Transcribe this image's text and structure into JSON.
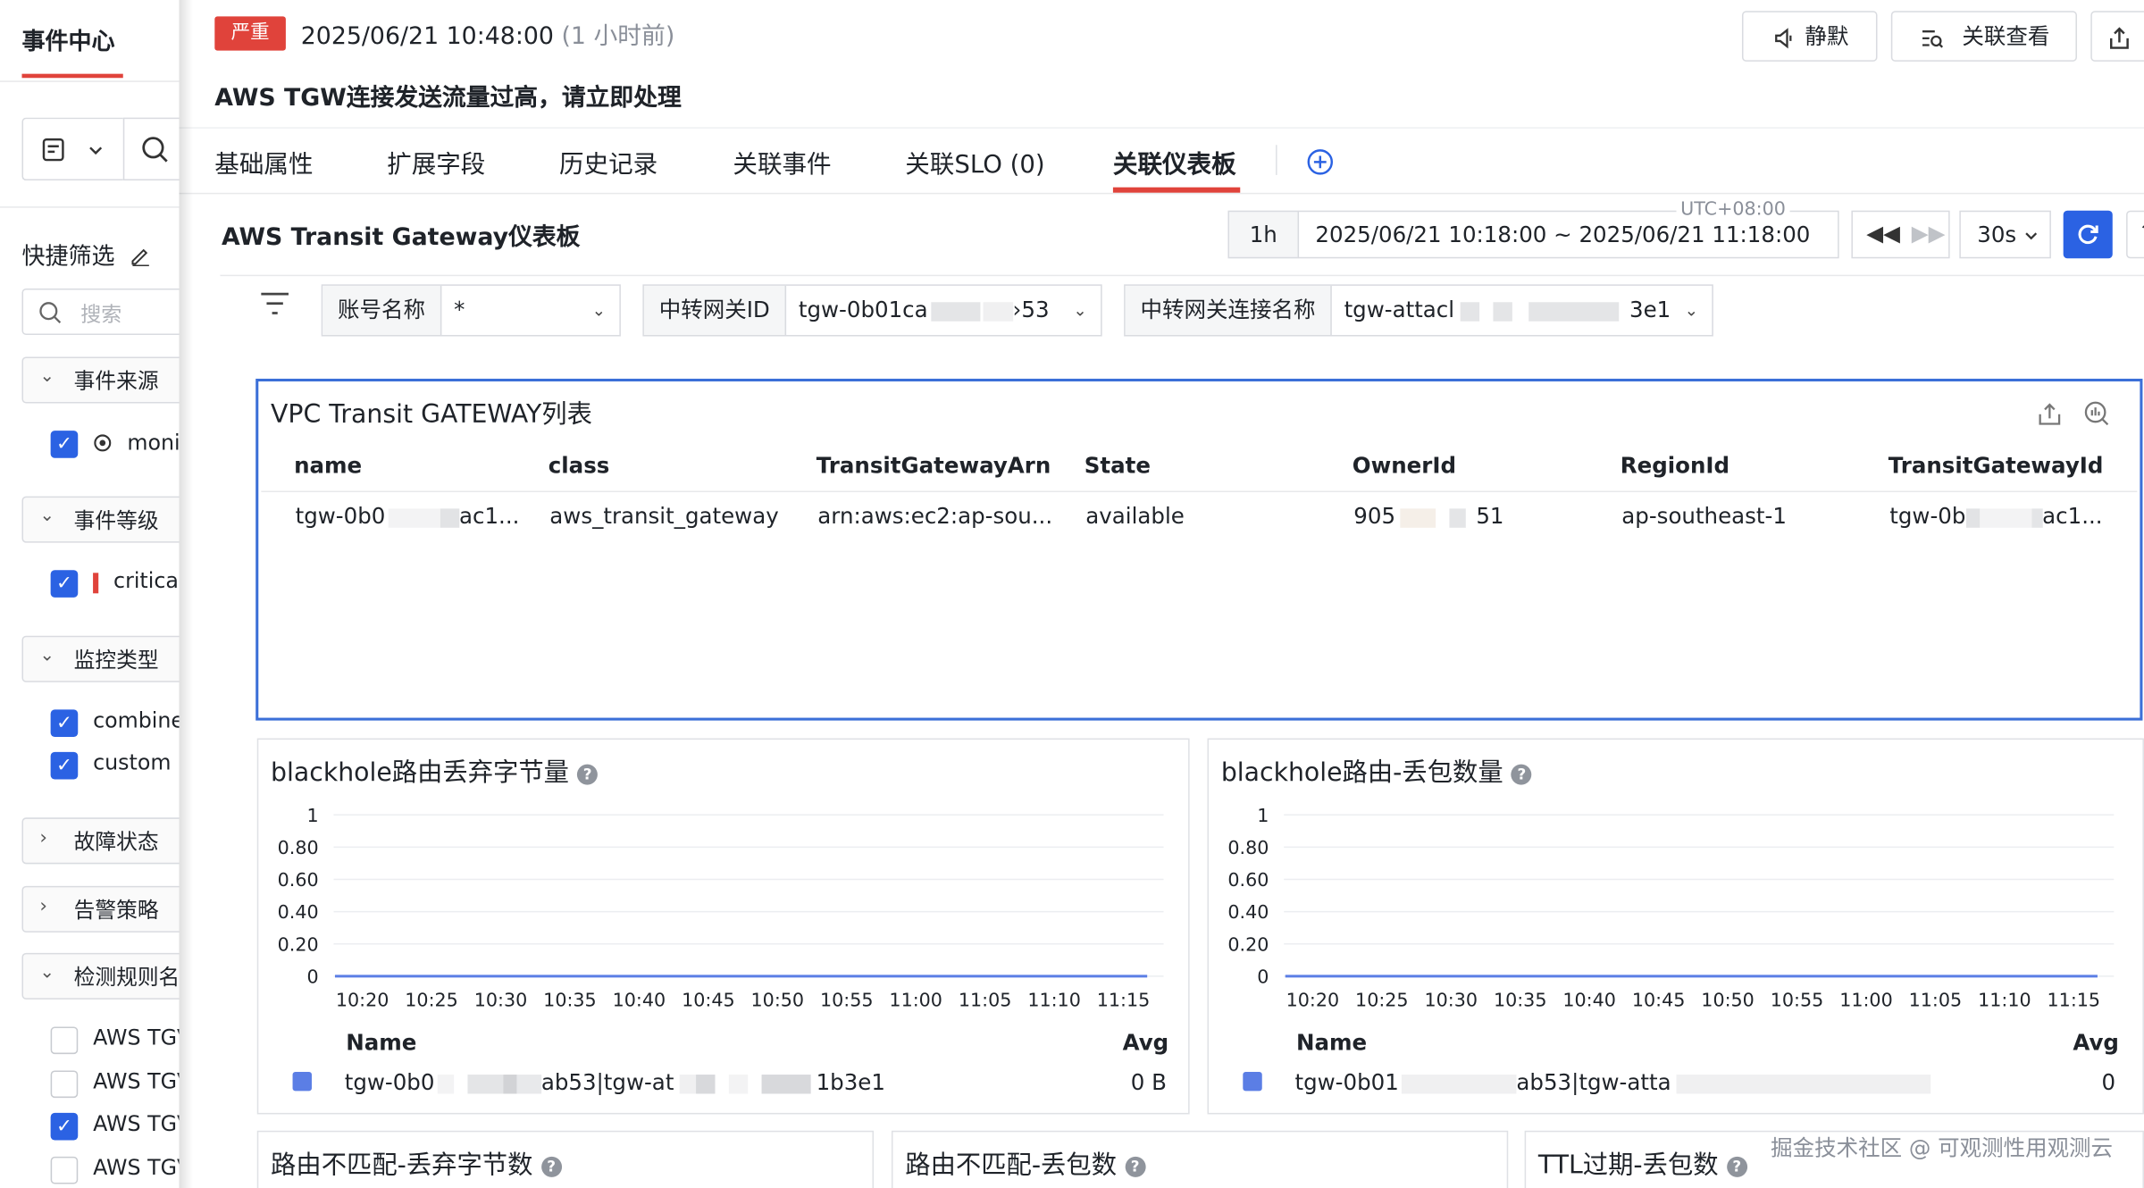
{
  "sidebar": {
    "title": "事件中心",
    "quick_filter": "快捷筛选",
    "search_placeholder": "搜索",
    "groups": [
      {
        "label": "事件来源",
        "options": [
          {
            "label": "moni",
            "checked": true
          }
        ]
      },
      {
        "label": "事件等级",
        "options": [
          {
            "label": "critica",
            "checked": true
          }
        ]
      },
      {
        "label": "监控类型",
        "options": [
          {
            "label": "combine",
            "checked": true
          },
          {
            "label": "custom",
            "checked": true
          }
        ]
      },
      {
        "label": "故障状态"
      },
      {
        "label": "告警策略"
      },
      {
        "label": "检测规则名",
        "options": [
          {
            "label": "AWS TGV",
            "checked": false
          },
          {
            "label": "AWS TGV",
            "checked": false
          },
          {
            "label": "AWS TGV",
            "checked": true
          },
          {
            "label": "AWS TGV",
            "checked": false
          }
        ]
      }
    ]
  },
  "header": {
    "severity": "严重",
    "timestamp": "2025/06/21 10:48:00",
    "relative_time": "(1 小时前)",
    "mute_label": "静默",
    "related_view_label": "关联查看",
    "alert_title": "AWS TGW连接发送流量过高，请立即处理"
  },
  "tabs": [
    {
      "label": "基础属性"
    },
    {
      "label": "扩展字段"
    },
    {
      "label": "历史记录"
    },
    {
      "label": "关联事件"
    },
    {
      "label": "关联SLO (0)"
    },
    {
      "label": "关联仪表板",
      "active": true
    }
  ],
  "dashboard": {
    "title": "AWS Transit Gateway仪表板",
    "time_quick": "1h",
    "timezone": "UTC+08:00",
    "time_range": "2025/06/21 10:18:00 ~ 2025/06/21 11:18:00",
    "refresh_interval": "30s",
    "filters": [
      {
        "key": "账号名称",
        "value": "*"
      },
      {
        "key": "中转网关ID",
        "value_prefix": "tgw-0b01ca",
        "value_suffix": "53"
      },
      {
        "key": "中转网关连接名称",
        "value_prefix": "tgw-attacl",
        "value_suffix": "3e1"
      }
    ]
  },
  "table_panel": {
    "title": "VPC Transit GATEWAY列表",
    "columns": [
      "name",
      "class",
      "TransitGatewayArn",
      "State",
      "OwnerId",
      "RegionId",
      "TransitGatewayId"
    ],
    "rows": [
      {
        "name_prefix": "tgw-0b0",
        "name_suffix": "ac1...",
        "class": "aws_transit_gateway",
        "arn": "arn:aws:ec2:ap-sou...",
        "state": "available",
        "owner_prefix": "905",
        "owner_suffix": "51",
        "region": "ap-southeast-1",
        "tgwid_prefix": "tgw-0b",
        "tgwid_suffix": "ac1..."
      }
    ]
  },
  "charts": [
    {
      "title": "blackhole路由丢弃字节量",
      "legend_name_header": "Name",
      "legend_avg_header": "Avg",
      "legend_name_prefix": "tgw-0b0",
      "legend_name_mid": "ab53|tgw-at",
      "legend_name_suffix": "1b3e1",
      "legend_avg": "0 B"
    },
    {
      "title": "blackhole路由-丢包数量",
      "legend_name_header": "Name",
      "legend_avg_header": "Avg",
      "legend_name_prefix": "tgw-0b01",
      "legend_name_mid": "ab53|tgw-atta",
      "legend_name_suffix": "",
      "legend_avg": "0"
    }
  ],
  "chart_data": [
    {
      "type": "line",
      "title": "blackhole路由丢弃字节量",
      "x": [
        "10:20",
        "10:25",
        "10:30",
        "10:35",
        "10:40",
        "10:45",
        "10:50",
        "10:55",
        "11:00",
        "11:05",
        "11:10",
        "11:15"
      ],
      "y_ticks": [
        "1",
        "0.80",
        "0.60",
        "0.40",
        "0.20",
        "0"
      ],
      "ylim": [
        0,
        1
      ],
      "series": [
        {
          "name": "tgw-0b0…ab53|tgw-at…1b3e1",
          "values": [
            0,
            0,
            0,
            0,
            0,
            0,
            0,
            0,
            0,
            0,
            0,
            0
          ],
          "color": "#5b7ee5"
        }
      ]
    },
    {
      "type": "line",
      "title": "blackhole路由-丢包数量",
      "x": [
        "10:20",
        "10:25",
        "10:30",
        "10:35",
        "10:40",
        "10:45",
        "10:50",
        "10:55",
        "11:00",
        "11:05",
        "11:10",
        "11:15"
      ],
      "y_ticks": [
        "1",
        "0.80",
        "0.60",
        "0.40",
        "0.20",
        "0"
      ],
      "ylim": [
        0,
        1
      ],
      "series": [
        {
          "name": "tgw-0b01…ab53|tgw-atta…",
          "values": [
            0,
            0,
            0,
            0,
            0,
            0,
            0,
            0,
            0,
            0,
            0,
            0
          ],
          "color": "#5b7ee5"
        }
      ]
    }
  ],
  "bottom_panels": [
    {
      "title": "路由不匹配-丢弃字节数"
    },
    {
      "title": "路由不匹配-丢包数"
    },
    {
      "title": "TTL过期-丢包数"
    }
  ],
  "watermark": "掘金技术社区 @ 可观测性用观测云",
  "colors": {
    "severity": "#e0433b",
    "accent": "#2b62e3",
    "series": "#5b7ee5",
    "selected_border": "#3b6fd8"
  }
}
